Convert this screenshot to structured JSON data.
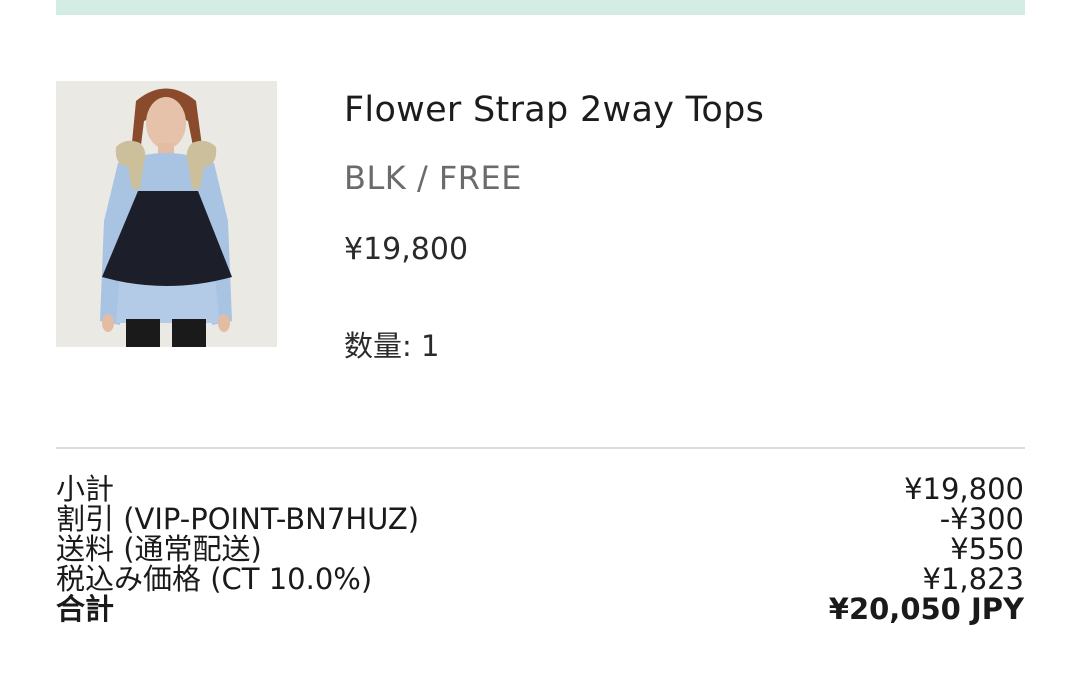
{
  "product": {
    "image_alt": "model wearing flower strap 2way top",
    "name": "Flower Strap 2way Tops",
    "variant": "BLK / FREE",
    "price": "¥19,800",
    "quantity": "数量: 1"
  },
  "summary": {
    "rows": [
      {
        "label": "小計",
        "value": "¥19,800"
      },
      {
        "label": "割引 (VIP-POINT-BN7HUZ)",
        "value": "-¥300"
      },
      {
        "label": "送料 (通常配送)",
        "value": "¥550"
      },
      {
        "label": "税込み価格 (CT 10.0%)",
        "value": "¥1,823"
      }
    ],
    "total": {
      "label": "合計",
      "value": "¥20,050 JPY"
    }
  },
  "colors": {
    "banner": "#d3ece4",
    "divider": "#dcdcdc",
    "text_primary": "#1a1a1a",
    "text_muted": "#6b6b6b"
  }
}
